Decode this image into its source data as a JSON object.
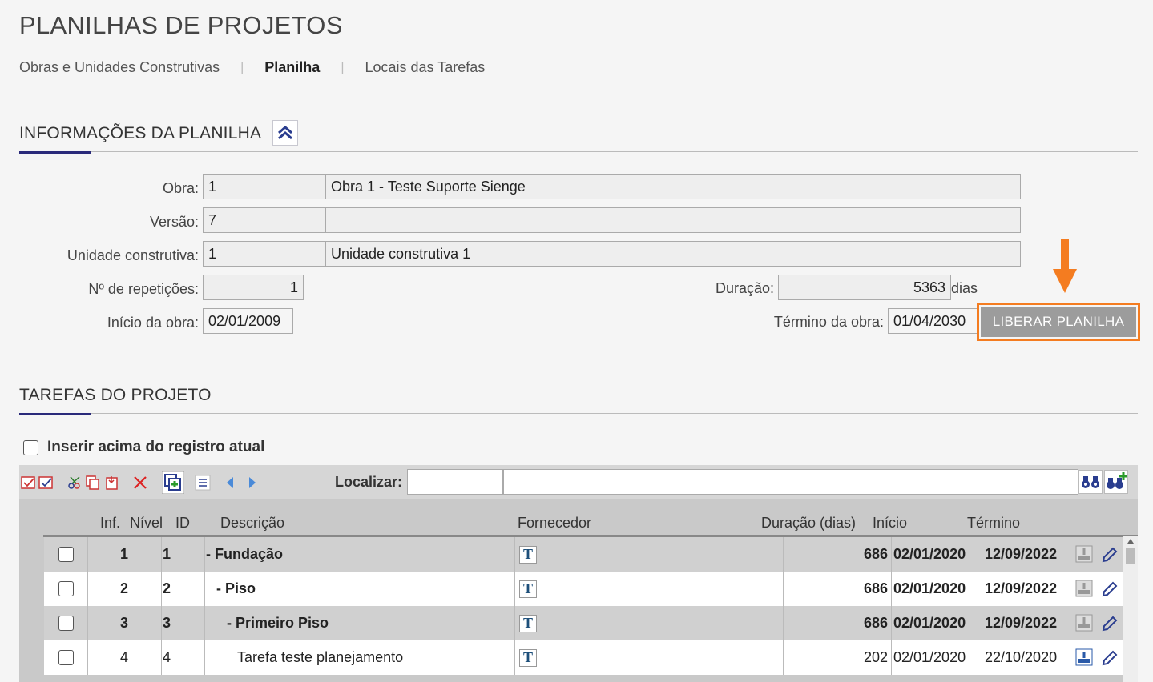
{
  "page": {
    "title": "PLANILHAS DE PROJETOS"
  },
  "tabs": [
    {
      "label": "Obras e Unidades Construtivas"
    },
    {
      "label": "Planilha"
    },
    {
      "label": "Locais das Tarefas"
    }
  ],
  "info_section": {
    "title": "INFORMAÇÕES DA PLANILHA",
    "obra": {
      "label": "Obra:",
      "code": "1",
      "name": "Obra 1 - Teste Suporte Sienge"
    },
    "versao": {
      "label": "Versão:",
      "code": "7",
      "name": ""
    },
    "unidade": {
      "label": "Unidade construtiva:",
      "code": "1",
      "name": "Unidade construtiva 1"
    },
    "repeticoes": {
      "label": "Nº de repetições:",
      "value": "1"
    },
    "duracao": {
      "label": "Duração:",
      "value": "5363",
      "unit": "dias"
    },
    "inicio": {
      "label": "Início da obra:",
      "value": "02/01/2009"
    },
    "termino": {
      "label": "Término da obra:",
      "value": "01/04/2030"
    },
    "release_button": "LIBERAR PLANILHA",
    "highlight_color": "#f47c20"
  },
  "tasks_section": {
    "title": "TAREFAS DO PROJETO",
    "insert_above_label": "Inserir acima do registro atual",
    "find_label": "Localizar:",
    "columns": {
      "inf": "Inf.",
      "nivel": "Nível",
      "id": "ID",
      "descricao": "Descrição",
      "fornecedor": "Fornecedor",
      "duracao": "Duração (dias)",
      "inicio": "Início",
      "termino": "Término"
    },
    "rows": [
      {
        "nivel": "1",
        "id": "1",
        "descricao": "- Fundação",
        "duracao": "686",
        "inicio": "02/01/2020",
        "termino": "12/09/2022",
        "bold": true
      },
      {
        "nivel": "2",
        "id": "2",
        "descricao": "- Piso",
        "duracao": "686",
        "inicio": "02/01/2020",
        "termino": "12/09/2022",
        "bold": true
      },
      {
        "nivel": "3",
        "id": "3",
        "descricao": "- Primeiro Piso",
        "duracao": "686",
        "inicio": "02/01/2020",
        "termino": "12/09/2022",
        "bold": true
      },
      {
        "nivel": "4",
        "id": "4",
        "descricao": "Tarefa teste planejamento",
        "duracao": "202",
        "inicio": "02/01/2020",
        "termino": "22/10/2020",
        "bold": false
      }
    ]
  }
}
